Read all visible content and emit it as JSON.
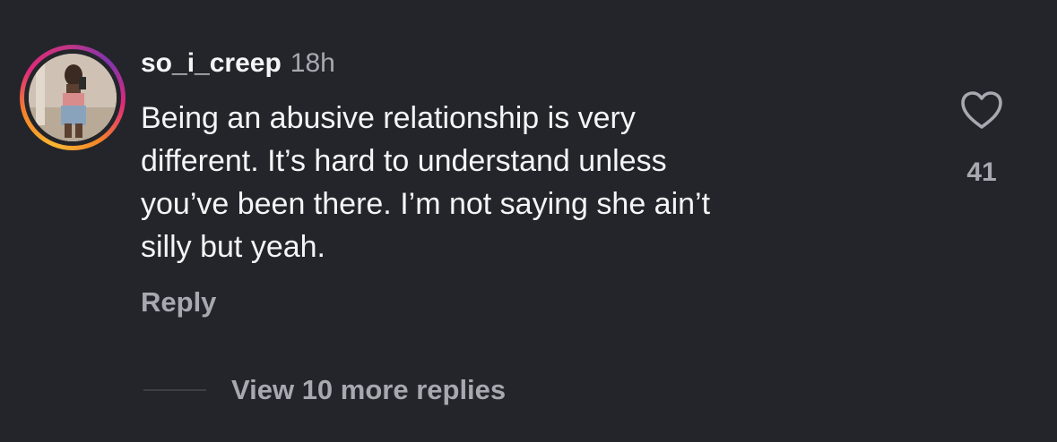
{
  "comment": {
    "username": "so_i_creep",
    "timestamp": "18h",
    "text": "Being an abusive relationship is very\ndifferent. It’s hard to understand unless\nyou’ve been there. I’m not saying she ain’t\nsilly but yeah.",
    "reply_label": "Reply",
    "like_count": "41",
    "like_icon": "heart-outline-icon",
    "view_replies_label": "View 10 more replies"
  },
  "colors": {
    "background": "#23252a",
    "primary_text": "#f4f5f7",
    "secondary_text": "#a6a9b0"
  }
}
